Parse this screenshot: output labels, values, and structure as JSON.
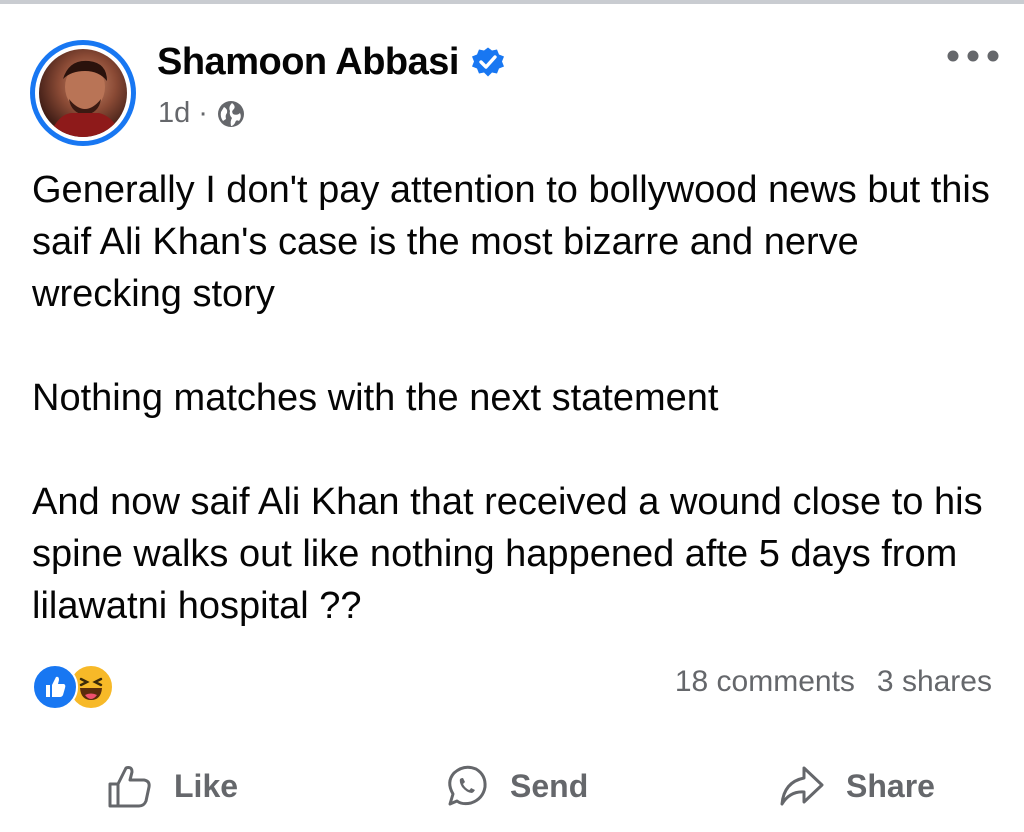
{
  "post": {
    "author": {
      "name": "Shamoon Abbasi",
      "verified": true
    },
    "timestamp": "1d",
    "separator": "·",
    "audience_icon": "globe-icon",
    "more_icon": "more-horizontal-icon",
    "text": {
      "p1": "Generally I don't pay attention to bollywood news but this saif Ali Khan's case is the most bizarre and nerve wrecking story",
      "p2": "Nothing matches with the next statement",
      "p3": "And now saif Ali Khan that received a wound close to his spine walks out like nothing happened afte 5 days from lilawatni hospital ??"
    },
    "reactions": [
      "like-reaction-icon",
      "haha-reaction-icon"
    ],
    "comments": "18 comments",
    "shares": "3 shares"
  },
  "actions": {
    "like_label": "Like",
    "send_label": "Send",
    "share_label": "Share"
  },
  "colors": {
    "brand_blue": "#1877f2",
    "secondary_text": "#65676b",
    "haha_yellow": "#f7b928"
  }
}
